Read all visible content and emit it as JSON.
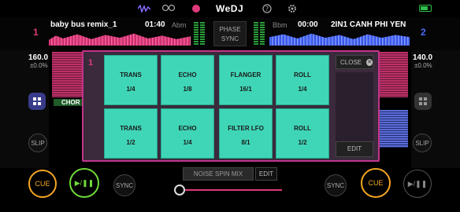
{
  "app": {
    "title": "WeDJ"
  },
  "top_icons": [
    "waveform-icon",
    "pioneer-logo-icon",
    "record-icon",
    "help-icon",
    "settings-icon",
    "battery-icon"
  ],
  "top_icon_labels": {
    "pioneer": "PIONEER"
  },
  "deck_left": {
    "number": "1",
    "track": "baby bus remix_1",
    "time": "01:40",
    "key": "Abm",
    "bpm": "160.0",
    "pitch": "±0.0%",
    "chord_label": "CHOR",
    "slip": "SLIP",
    "cue": "CUE",
    "play": "▶/❚❚",
    "sync": "SYNC"
  },
  "deck_right": {
    "number": "2",
    "track": "2IN1 CANH PHI YEN",
    "time": "00:00",
    "key": "Bbm",
    "bpm": "140.0",
    "pitch": "±0.0%",
    "slip": "SLIP",
    "cue": "CUE",
    "play": "▶/❚❚",
    "sync": "SYNC"
  },
  "phase_sync": {
    "line1": "PHASE",
    "line2": "SYNC"
  },
  "fx_panel": {
    "deck_number": "1",
    "close_label": "CLOSE",
    "edit_label": "EDIT",
    "pads": [
      {
        "name": "TRANS",
        "value": "1/4"
      },
      {
        "name": "ECHO",
        "value": "1/8"
      },
      {
        "name": "FLANGER",
        "value": "16/1"
      },
      {
        "name": "ROLL",
        "value": "1/4"
      },
      {
        "name": "TRANS",
        "value": "1/2"
      },
      {
        "name": "ECHO",
        "value": "1/4"
      },
      {
        "name": "FILTER LFO",
        "value": "8/1"
      },
      {
        "name": "ROLL",
        "value": "1/2"
      }
    ]
  },
  "bottom": {
    "noise_mix": "NOISE SPIN MIX",
    "noise_edit": "EDIT"
  },
  "colors": {
    "deck1": "#e0397a",
    "deck2": "#4a6bff",
    "pad": "#3fd6b7",
    "cue": "#f5a623",
    "play": "#6fdc3a"
  }
}
